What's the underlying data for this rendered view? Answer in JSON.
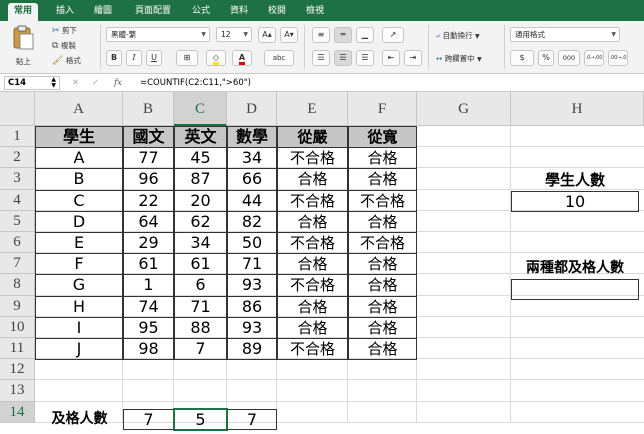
{
  "ribbon": {
    "tabs": [
      "常用",
      "插入",
      "繪圖",
      "頁面配置",
      "公式",
      "資料",
      "校閱",
      "檢視"
    ],
    "active_tab": 0,
    "paste_label": "貼上",
    "cut_label": "剪下",
    "copy_label": "複製",
    "format_painter_label": "格式",
    "font_name": "黑體-繁",
    "font_size": "12",
    "grow_font": "A▴",
    "shrink_font": "A▾",
    "bold": "B",
    "italic": "I",
    "underline": "U",
    "font_color_glyph": "A",
    "phonetic_glyph": "abc",
    "wrap_text_label": "自動換行",
    "merge_label": "跨欄置中",
    "number_format": "通用格式",
    "currency": "$",
    "percent": "%",
    "comma": "000",
    "inc_decimal": ".0→.00",
    "dec_decimal": ".00→.0"
  },
  "formula_bar": {
    "name_box": "C14",
    "cancel": "✕",
    "enter": "✓",
    "fx": "fx",
    "formula": "=COUNTIF(C2:C11,\">60\")"
  },
  "sheet": {
    "columns": [
      "A",
      "B",
      "C",
      "D",
      "E",
      "F",
      "G",
      "H"
    ],
    "selected_column": "C",
    "rows": [
      "1",
      "2",
      "3",
      "4",
      "5",
      "6",
      "7",
      "8",
      "9",
      "10",
      "11",
      "12",
      "13",
      "14"
    ],
    "selected_row": "14",
    "headers": [
      "學生",
      "國文",
      "英文",
      "數學",
      "從嚴",
      "從寬"
    ],
    "records": [
      [
        "A",
        "77",
        "45",
        "34",
        "不合格",
        "合格"
      ],
      [
        "B",
        "96",
        "87",
        "66",
        "合格",
        "合格"
      ],
      [
        "C",
        "22",
        "20",
        "44",
        "不合格",
        "不合格"
      ],
      [
        "D",
        "64",
        "62",
        "82",
        "合格",
        "合格"
      ],
      [
        "E",
        "29",
        "34",
        "50",
        "不合格",
        "不合格"
      ],
      [
        "F",
        "61",
        "61",
        "71",
        "合格",
        "合格"
      ],
      [
        "G",
        "1",
        "6",
        "93",
        "不合格",
        "合格"
      ],
      [
        "H",
        "74",
        "71",
        "86",
        "合格",
        "合格"
      ],
      [
        "I",
        "95",
        "88",
        "93",
        "合格",
        "合格"
      ],
      [
        "J",
        "98",
        "7",
        "89",
        "不合格",
        "合格"
      ]
    ],
    "summary_label": "及格人數",
    "summary_values": [
      "7",
      "5",
      "7"
    ],
    "student_count_label": "學生人數",
    "student_count_value": "10",
    "both_pass_label": "兩種都及格人數",
    "both_pass_value": "",
    "selected_cell": "C14"
  },
  "colors": {
    "ribbon_green": "#1e7145",
    "header_fill": "#c6c6c6",
    "selection": "#1e7145"
  }
}
